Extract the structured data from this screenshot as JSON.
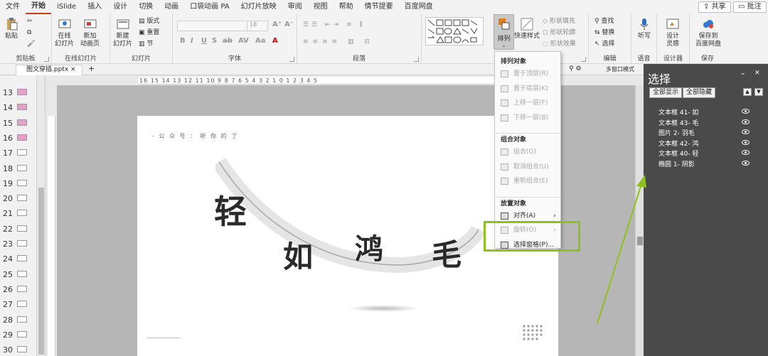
{
  "menu_tabs": [
    "文件",
    "开始",
    "iSlide",
    "插入",
    "设计",
    "切换",
    "动画",
    "口袋动画 PA",
    "幻灯片放映",
    "审阅",
    "视图",
    "帮助",
    "情节提要",
    "百度网盘"
  ],
  "header": {
    "share": "共享",
    "comment": "批注"
  },
  "ribbon": {
    "clipboard": {
      "label": "剪贴板",
      "paste": "粘贴"
    },
    "online_slides": {
      "label": "在线幻灯片",
      "online": "在线\n幻灯片",
      "new_anim": "新加\n动画页"
    },
    "slides": {
      "label": "幻灯片",
      "new": "新建\n幻灯片",
      "layout": "版式",
      "reset": "重置",
      "section": "节"
    },
    "font": {
      "label": "字体",
      "size": "18",
      "format_chars": [
        "B",
        "I",
        "U",
        "S",
        "ab",
        "AV",
        "Aa",
        "A"
      ]
    },
    "paragraph": {
      "label": "段落"
    },
    "drawing": {
      "arrange": "排列",
      "quick_styles": "快速样式",
      "fill": "形状填充",
      "outline": "形状轮廓",
      "effects": "形状效果"
    },
    "editing": {
      "label": "编辑",
      "find": "查找",
      "replace": "替换",
      "select": "选择"
    },
    "voice": {
      "label": "语音",
      "dictate": "听写"
    },
    "designer": {
      "label": "设计器",
      "ideas": "设计\n灵感"
    },
    "save": {
      "label": "保存",
      "baidu": "保存到\n百度网盘"
    }
  },
  "document": {
    "filename": "图文穿插.pptx",
    "view_mode": "多窗口模式"
  },
  "ruler_h": "16 15 14 13 12 11 10  9  8  7  6  5  4  3  2  1  0  1  2  3  4  5",
  "thumbnails": [
    "13",
    "14",
    "15",
    "16",
    "17",
    "18",
    "19",
    "20",
    "21",
    "22",
    "23",
    "24",
    "25",
    "26",
    "27",
    "28",
    "29",
    "30"
  ],
  "slide": {
    "wechat": "- 公 众 号 ： 听 你 的 了",
    "chars": [
      "轻",
      "如",
      "鸿",
      "毛"
    ]
  },
  "dropdown": {
    "sections": [
      {
        "title": "排列对象",
        "items": [
          {
            "label": "置于顶层(R)",
            "enabled": false
          },
          {
            "label": "置于底层(K)",
            "enabled": false
          },
          {
            "label": "上移一层(F)",
            "enabled": false
          },
          {
            "label": "下移一层(B)",
            "enabled": false
          }
        ]
      },
      {
        "title": "组合对象",
        "items": [
          {
            "label": "组合(G)",
            "enabled": false
          },
          {
            "label": "取消组合(U)",
            "enabled": false
          },
          {
            "label": "重新组合(E)",
            "enabled": false
          }
        ]
      },
      {
        "title": "放置对象",
        "items": [
          {
            "label": "对齐(A)",
            "enabled": true,
            "submenu": true
          },
          {
            "label": "旋转(O)",
            "enabled": false,
            "submenu": true
          },
          {
            "label": "选择窗格(P)...",
            "enabled": true
          }
        ]
      }
    ]
  },
  "selection_pane": {
    "title": "选择",
    "show_all": "全部显示",
    "hide_all": "全部隐藏",
    "items": [
      "文本框 41- 如",
      "文本框 43- 毛",
      "图片 2- 羽毛",
      "文本框 42- 鸿",
      "文本框 40- 轻",
      "椭圆 1- 阴影"
    ]
  },
  "colors": {
    "highlight": "#8ec11e",
    "active_tab": "#c43e1c",
    "pane_bg": "#4a4a4a"
  }
}
